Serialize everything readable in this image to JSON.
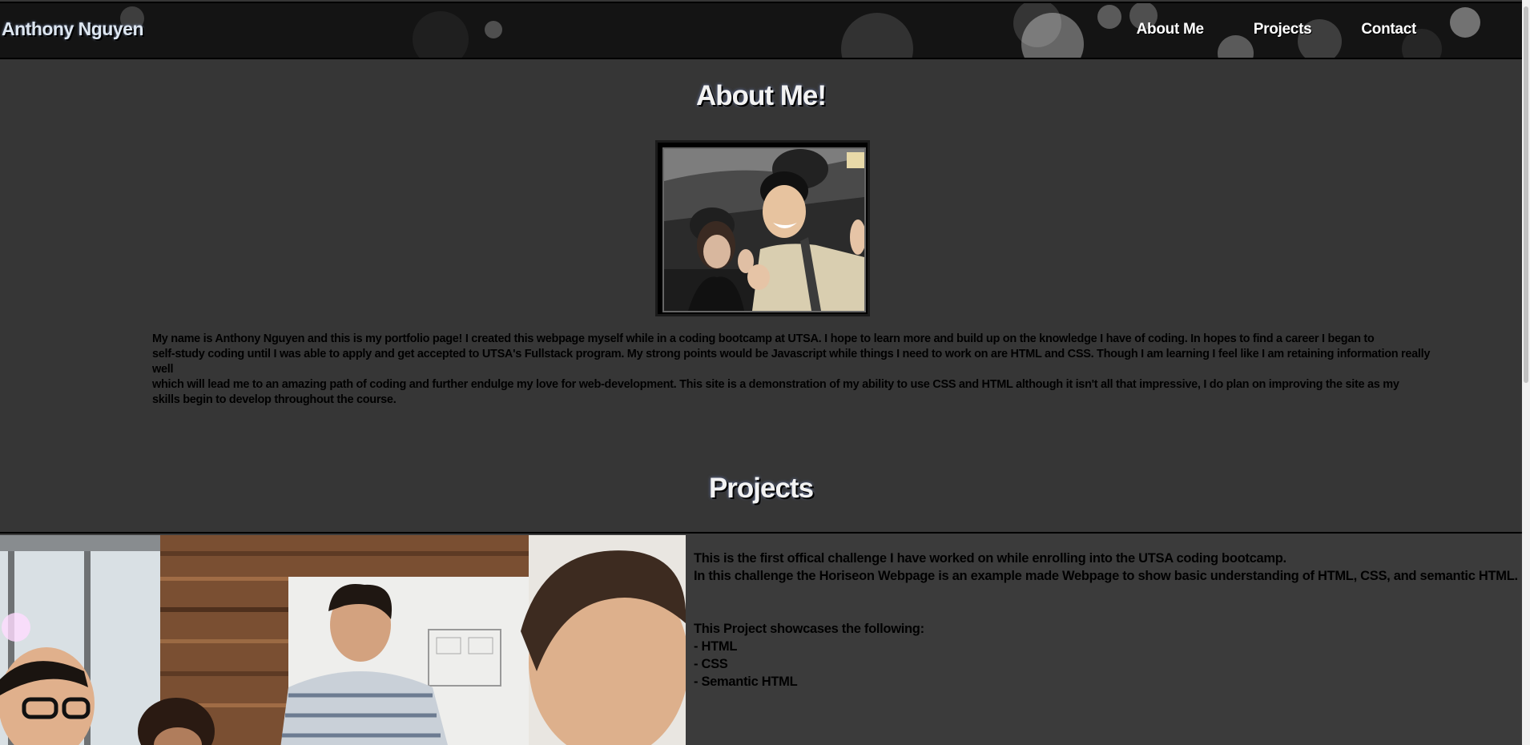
{
  "header": {
    "brand": "Anthony Nguyen",
    "nav": [
      "About Me",
      "Projects",
      "Contact"
    ]
  },
  "about": {
    "title": "About Me!",
    "lines": [
      "My name is Anthony Nguyen and this is my portfolio page! I created this webpage myself while in a coding bootcamp at UTSA. I hope to learn more and build up on the knowledge I have of coding. In hopes to find a career I began to",
      "self-study coding until I was able to apply and get accepted to UTSA's Fullstack program. My strong points would be Javascript while things I need to work on are HTML and CSS. Though I am learning I feel like I am retaining information really well",
      "which will lead me to an amazing path of coding and further endulge my love for web-development. This site is a demonstration of my ability to use CSS and HTML although it isn't all that impressive, I do plan on improving the site as my",
      "skills begin to develop throughout the course."
    ]
  },
  "projects": {
    "title": "Projects",
    "intro_lines": [
      "This is the first offical challenge I have worked on while enrolling into the UTSA coding bootcamp.",
      "In this challenge the Horiseon Webpage is an example made Webpage to show basic understanding of HTML, CSS, and semantic HTML."
    ],
    "showcase_lines": [
      "This Project showcases the following:",
      "- HTML",
      "- CSS",
      "- Semantic HTML"
    ]
  },
  "colors": {
    "background": "#363636",
    "header": "#141414",
    "heading_text": "#f2f2f2",
    "body_text": "#000000"
  }
}
